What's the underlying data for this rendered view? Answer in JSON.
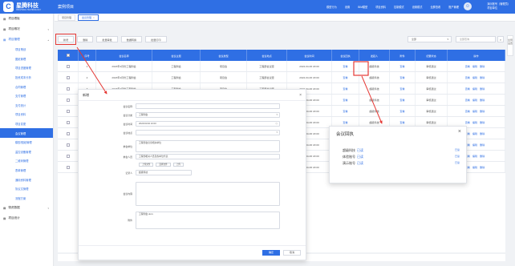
{
  "app": {
    "brand_cn": "星腾科技",
    "brand_en": "XINGTENG TECHNOLOGY",
    "brand_mark": "C",
    "system_name": "案例项目"
  },
  "header": {
    "links": [
      "模型行为",
      "设置",
      "BIM模型",
      "项目资料",
      "控制模式",
      "设置模式",
      "全屏查看",
      "账户管理"
    ],
    "avatar_glyph": "☺",
    "user_name": "演示账号（管理员）",
    "user_role": "项目单位"
  },
  "sidebar": {
    "groups": [
      {
        "label": "项目看板",
        "icon": "▤"
      },
      {
        "label": "项目概况",
        "icon": "▤",
        "chev": "▾"
      },
      {
        "label": "项目管理",
        "icon": "▤",
        "chev": "▴"
      }
    ],
    "items": [
      "项目策划",
      "图纸管理",
      "项目进度管理",
      "投资成本分析",
      "合同管理",
      "支付管理",
      "支付统计",
      "项目资料",
      "项目变更",
      "会议管理",
      "模型/图纸管理",
      "监控设备管理",
      "二维码管理",
      "表单管理",
      "通用资料管理",
      "协议文管理",
      "流程方案"
    ],
    "bottom": [
      {
        "label": "物资数据",
        "icon": "▤",
        "chev": "▾"
      },
      {
        "label": "项目统计",
        "icon": "▤"
      }
    ]
  },
  "tabs": [
    {
      "label": "项目管理"
    },
    {
      "label": "会议管理",
      "close": "×"
    }
  ],
  "toolbar": {
    "buttons": [
      "新增",
      "删除",
      "批量审批",
      "数据转换",
      "批量打印"
    ],
    "select_value": "全部",
    "select_arrow": "▾",
    "search_placeholder": "全部查询",
    "search_icon": "⌕"
  },
  "table": {
    "columns": [
      "序号",
      "会议名称",
      "会议主题",
      "会议类型",
      "会议地点",
      "会议时间",
      "会议回执",
      "发起人",
      "附件",
      "纪要状态",
      "操作"
    ],
    "rows": [
      {
        "no": "1",
        "name": "2023年4月份工程例会",
        "topic": "工程例会",
        "type": "项目会",
        "place": "工程部会议室",
        "time": "2022-04-06 18:00",
        "receipt": "查看",
        "initiator": "超级科技",
        "attach": "查看",
        "status": "审核通过"
      },
      {
        "no": "2",
        "name": "2023年4月份工程例会",
        "topic": "工程例会",
        "type": "项目会",
        "place": "工程部会议室",
        "time": "2022-04-06 18:00",
        "receipt": "查看",
        "initiator": "超级科技",
        "attach": "查看",
        "status": "审核通过"
      },
      {
        "no": "3",
        "name": "2023年4月份工程例会",
        "topic": "工程例会",
        "type": "项目会",
        "place": "工程部会议室",
        "time": "2022-04-06 18:00",
        "receipt": "查看",
        "initiator": "超级科技",
        "attach": "查看",
        "status": "审核通过"
      },
      {
        "no": "4",
        "name": "2023年4月份工程例会",
        "topic": "工程例会",
        "type": "项目会",
        "place": "工程部会议室",
        "time": "2022-04-06 18:00",
        "receipt": "查看",
        "initiator": "超级科技",
        "attach": "查看",
        "status": "审核通过"
      },
      {
        "no": "5",
        "name": "2023年4月份工程例会",
        "topic": "工程例会",
        "type": "项目会",
        "place": "工程部会议室",
        "time": "2022-04-06 18:00",
        "receipt": "查看",
        "initiator": "超级科技",
        "attach": "查看",
        "status": "审核通过"
      },
      {
        "no": "6",
        "name": "2023年4月份工程例会",
        "topic": "工程例会",
        "type": "项目会",
        "place": "工程部会议室",
        "time": "2022-04-06 18:00",
        "receipt": "查看",
        "initiator": "超级科技",
        "attach": "查看",
        "status": "审核通过"
      },
      {
        "no": "7",
        "name": "2023年4月份工程例会",
        "topic": "工程例会",
        "type": "项目会",
        "place": "工程部会议室",
        "time": "2022-04-06 18:00",
        "receipt": "查看",
        "initiator": "超级科技",
        "attach": "查看",
        "status": "审核通过"
      },
      {
        "no": "8",
        "name": "2023年4月份工程例会",
        "topic": "工程例会",
        "type": "项目会",
        "place": "工程部会议室",
        "time": "2022-04-06 18:00",
        "receipt": "查看",
        "initiator": "超级科技",
        "attach": "查看",
        "status": "审核通过"
      },
      {
        "no": "9",
        "name": "2023年4月份工程例会",
        "topic": "工程例会",
        "type": "项目会",
        "place": "工程部会议室",
        "time": "2022-04-06 18:00",
        "receipt": "查看",
        "initiator": "超级科技",
        "attach": "查看",
        "status": "审核通过"
      },
      {
        "no": "10",
        "name": "2023年4月份工程例会",
        "topic": "工程例会",
        "type": "项目会",
        "place": "工程部会议室",
        "time": "2022-04-06 18:00",
        "receipt": "查看",
        "initiator": "超级科技",
        "attach": "查看",
        "status": "审核通过"
      }
    ],
    "ops": [
      "查看",
      "编辑",
      "删除"
    ]
  },
  "dialog": {
    "title": "新增",
    "close": "×",
    "fields": [
      {
        "label": "会议名称",
        "value": ""
      },
      {
        "label": "会议分类",
        "value": "工程例会",
        "dd": "▾"
      },
      {
        "label": "会议时间",
        "value": "2024/01/02 10:00",
        "dd": "◷"
      },
      {
        "label": "会议地点",
        "value": "",
        "dd": "▾"
      },
      {
        "label": "参会单位",
        "value": "工程部会议室相关单位"
      },
      {
        "label": "参会人员",
        "value": "工程部相关人员及各单位代表"
      },
      {
        "label": "记录人",
        "value": "超级科技"
      },
      {
        "label": "会议内容",
        "value": ""
      },
      {
        "label": "附件",
        "value": "工程例会.docx"
      }
    ],
    "uploads": [
      "上传文件",
      "选择文件",
      "上传"
    ],
    "cancel": "取消",
    "confirm": "确定"
  },
  "receipt": {
    "title": "会议回执",
    "close": "×",
    "rows": [
      {
        "name": "超级科技",
        "status": "已读",
        "icon": "已读"
      },
      {
        "name": "体验账号",
        "status": "已读",
        "icon": "已读"
      },
      {
        "name": "演示账号",
        "status": "已读",
        "icon": "已读"
      }
    ]
  },
  "right_rail": {
    "label": "全局设置"
  },
  "colors": {
    "accent": "#2f6fe4",
    "annotation": "#e53935"
  }
}
